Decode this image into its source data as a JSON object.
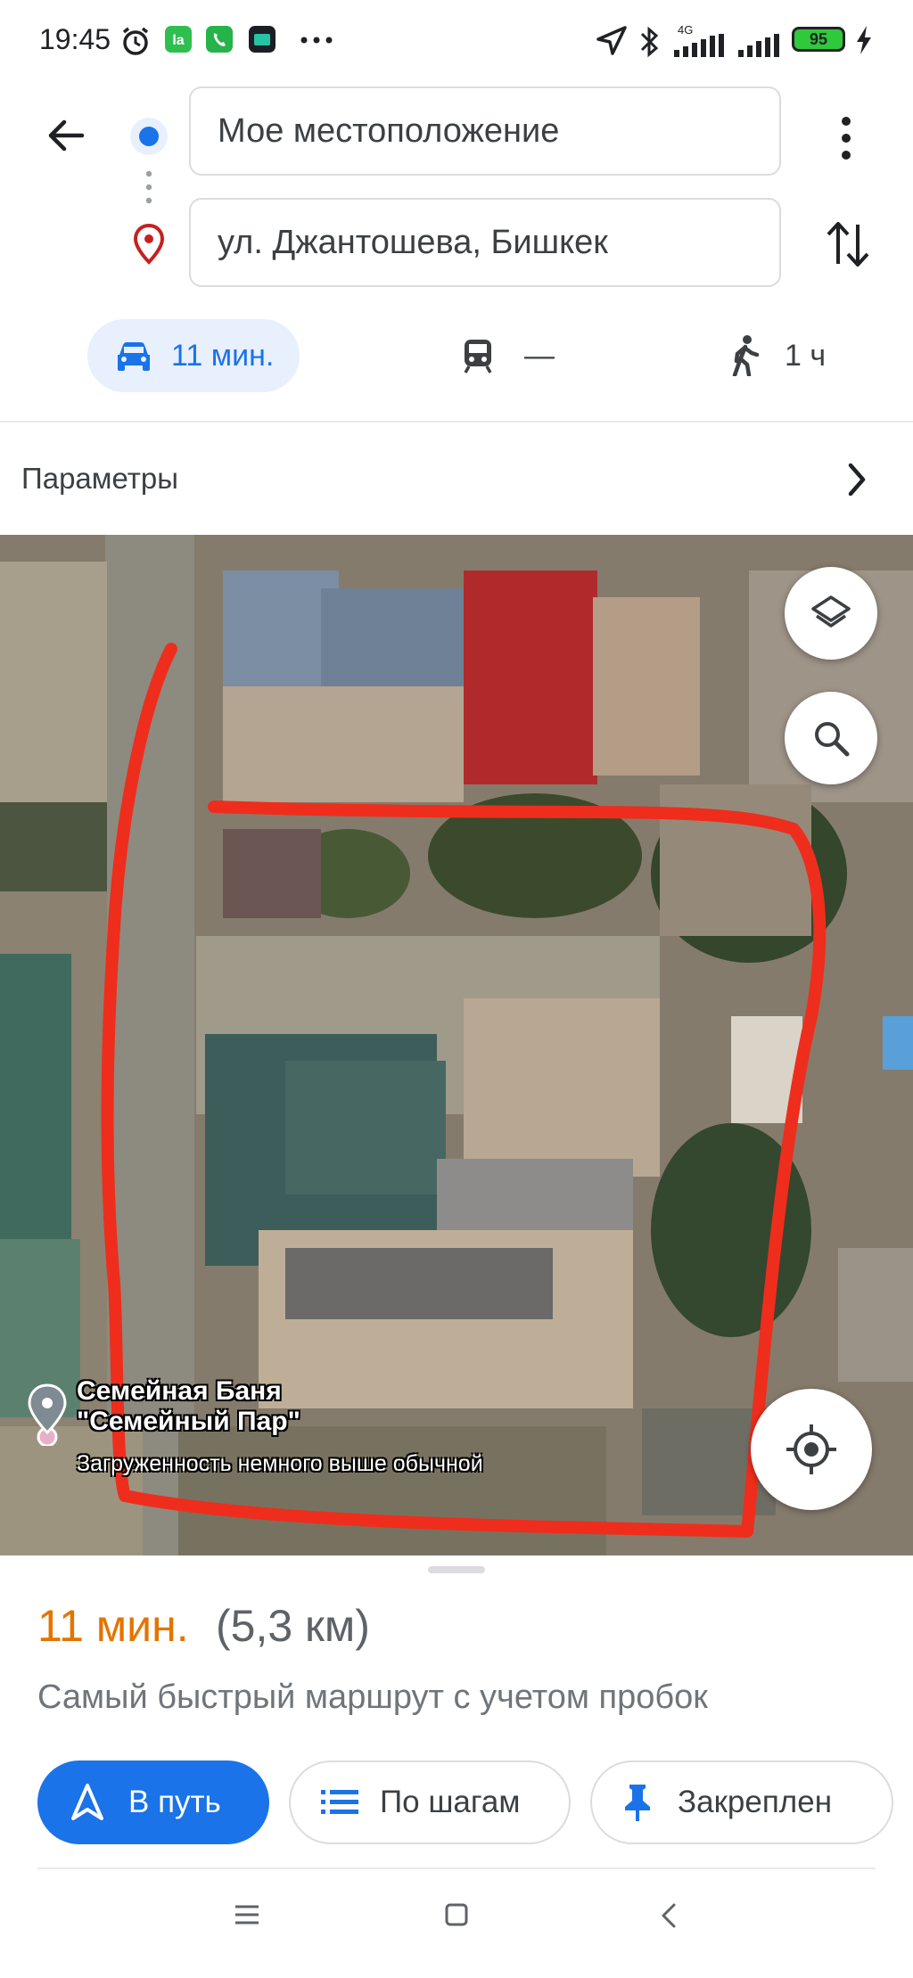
{
  "status_bar": {
    "time": "19:45",
    "network": "4G",
    "battery": "95",
    "icons": [
      "alarm-icon",
      "la-app-icon",
      "phone-app-icon",
      "wallet-app-icon",
      "more-dots-icon",
      "location-arrow-icon",
      "bluetooth-icon",
      "signal-icon",
      "signal-icon",
      "battery-icon",
      "charging-icon"
    ]
  },
  "header": {
    "origin": "Мое местоположение",
    "destination": "ул. Джантошева, Бишкек",
    "modes": [
      {
        "icon": "car-icon",
        "label": "11 мин.",
        "selected": true
      },
      {
        "icon": "transit-icon",
        "label": "—",
        "selected": false
      },
      {
        "icon": "walk-icon",
        "label": "1 ч",
        "selected": false
      }
    ],
    "options_label": "Параметры"
  },
  "map": {
    "poi_name_line1": "Семейная Баня",
    "poi_name_line2": "\"Семейный Пар\"",
    "poi_status": "Загруженность немного выше обычной"
  },
  "sheet": {
    "eta_time": "11 мин.",
    "eta_distance": "(5,3 км)",
    "description": "Самый быстрый маршрут с учетом пробок",
    "start_label": "В путь",
    "steps_label": "По шагам",
    "pinned_label": "Закреплен"
  },
  "colors": {
    "accent_blue": "#1a73e8",
    "eta_orange": "#e37400",
    "annotation_red": "#ef2d1c"
  }
}
